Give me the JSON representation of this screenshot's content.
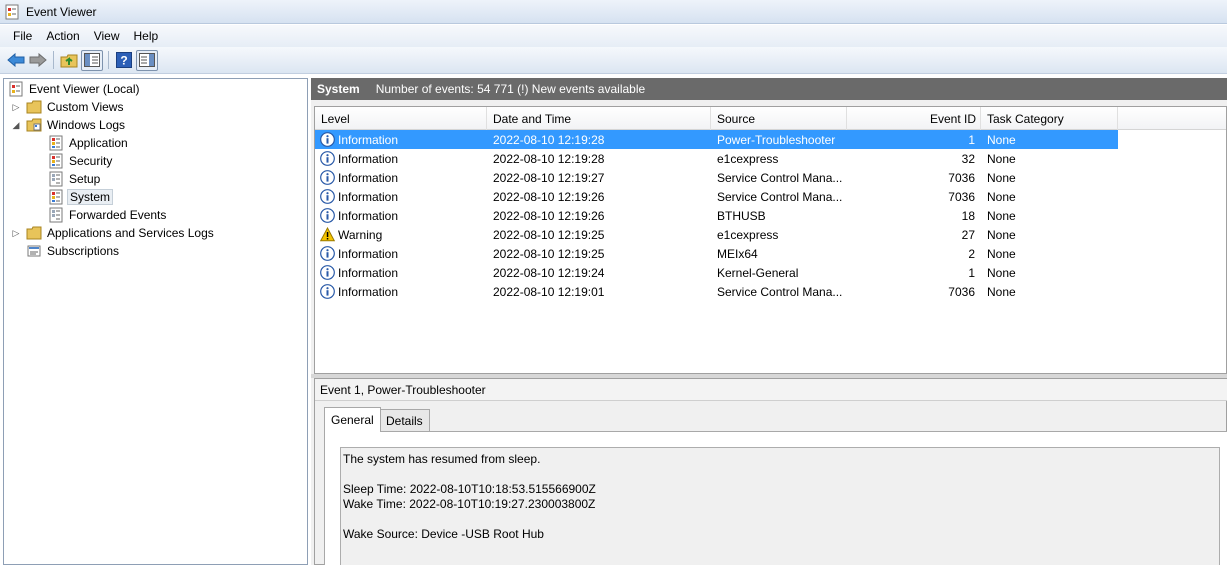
{
  "window": {
    "title": "Event Viewer"
  },
  "menu": [
    "File",
    "Action",
    "View",
    "Help"
  ],
  "tree": {
    "items": [
      {
        "label": "Event Viewer (Local)",
        "name": "tree-item-event-viewer-local"
      },
      {
        "label": "Custom Views",
        "name": "tree-item-custom-views"
      },
      {
        "label": "Windows Logs",
        "name": "tree-item-windows-logs"
      },
      {
        "label": "Application",
        "name": "tree-item-application"
      },
      {
        "label": "Security",
        "name": "tree-item-security"
      },
      {
        "label": "Setup",
        "name": "tree-item-setup"
      },
      {
        "label": "System",
        "name": "tree-item-system"
      },
      {
        "label": "Forwarded Events",
        "name": "tree-item-forwarded-events"
      },
      {
        "label": "Applications and Services Logs",
        "name": "tree-item-applications-services-logs"
      },
      {
        "label": "Subscriptions",
        "name": "tree-item-subscriptions"
      }
    ]
  },
  "log": {
    "name": "System",
    "summary": "Number of events: 54 771 (!) New events available"
  },
  "columns": {
    "level": "Level",
    "datetime": "Date and Time",
    "source": "Source",
    "event_id": "Event ID",
    "task_category": "Task Category"
  },
  "events": [
    {
      "level": "Information",
      "icon": "info-icon",
      "datetime": "2022-08-10 12:19:28",
      "source": "Power-Troubleshooter",
      "event_id": "1",
      "task": "None"
    },
    {
      "level": "Information",
      "icon": "info-icon",
      "datetime": "2022-08-10 12:19:28",
      "source": "e1cexpress",
      "event_id": "32",
      "task": "None"
    },
    {
      "level": "Information",
      "icon": "info-icon",
      "datetime": "2022-08-10 12:19:27",
      "source": "Service Control Mana...",
      "event_id": "7036",
      "task": "None"
    },
    {
      "level": "Information",
      "icon": "info-icon",
      "datetime": "2022-08-10 12:19:26",
      "source": "Service Control Mana...",
      "event_id": "7036",
      "task": "None"
    },
    {
      "level": "Information",
      "icon": "info-icon",
      "datetime": "2022-08-10 12:19:26",
      "source": "BTHUSB",
      "event_id": "18",
      "task": "None"
    },
    {
      "level": "Warning",
      "icon": "warning-icon",
      "datetime": "2022-08-10 12:19:25",
      "source": "e1cexpress",
      "event_id": "27",
      "task": "None"
    },
    {
      "level": "Information",
      "icon": "info-icon",
      "datetime": "2022-08-10 12:19:25",
      "source": "MEIx64",
      "event_id": "2",
      "task": "None"
    },
    {
      "level": "Information",
      "icon": "info-icon",
      "datetime": "2022-08-10 12:19:24",
      "source": "Kernel-General",
      "event_id": "1",
      "task": "None"
    },
    {
      "level": "Information",
      "icon": "info-icon",
      "datetime": "2022-08-10 12:19:01",
      "source": "Service Control Mana...",
      "event_id": "7036",
      "task": "None"
    }
  ],
  "detail": {
    "title": "Event 1, Power-Troubleshooter",
    "tabs": [
      "General",
      "Details"
    ],
    "message_lines": [
      "The system has resumed from sleep.",
      "",
      "Sleep Time: 2022-08-10T10:18:53.515566900Z",
      "Wake Time: 2022-08-10T10:19:27.230003800Z",
      "",
      "Wake Source: Device -USB Root Hub"
    ]
  },
  "colors": {
    "selection": "#3399ff",
    "header_bar": "#6a6a6a",
    "window_bg": "#f0f0f0"
  }
}
